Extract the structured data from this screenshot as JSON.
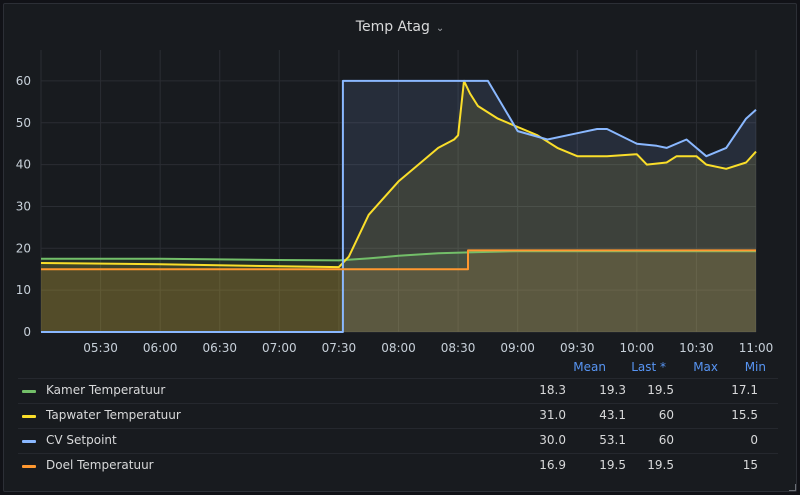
{
  "panel": {
    "title": "Temp Atag"
  },
  "legend": {
    "headers": [
      "Mean",
      "Last *",
      "Max",
      "Min"
    ],
    "rows": [
      {
        "name": "Kamer Temperatuur",
        "color": "#73bf69",
        "values": [
          "18.3",
          "19.3",
          "19.5",
          "17.1"
        ]
      },
      {
        "name": "Tapwater Temperatuur",
        "color": "#fade2a",
        "values": [
          "31.0",
          "43.1",
          "60",
          "15.5"
        ]
      },
      {
        "name": "CV Setpoint",
        "color": "#8ab8ff",
        "values": [
          "30.0",
          "53.1",
          "60",
          "0"
        ]
      },
      {
        "name": "Doel Temperatuur",
        "color": "#ff9830",
        "values": [
          "16.9",
          "19.5",
          "19.5",
          "15"
        ]
      }
    ]
  },
  "chart_data": {
    "type": "area",
    "title": "Temp Atag",
    "xlabel": "",
    "ylabel": "",
    "ylim": [
      0,
      65
    ],
    "y_ticks": [
      0,
      10,
      20,
      30,
      40,
      50,
      60
    ],
    "x_ticks": [
      "05:30",
      "06:00",
      "06:30",
      "07:00",
      "07:30",
      "08:00",
      "08:30",
      "09:00",
      "09:30",
      "10:00",
      "10:30",
      "11:00"
    ],
    "x_range": [
      "05:00",
      "11:00"
    ],
    "grid": true,
    "legend_position": "bottom",
    "series": [
      {
        "name": "Kamer Temperatuur",
        "color": "#73bf69",
        "points": [
          [
            "05:00",
            17.5
          ],
          [
            "06:00",
            17.5
          ],
          [
            "07:00",
            17.2
          ],
          [
            "07:30",
            17.1
          ],
          [
            "07:45",
            17.6
          ],
          [
            "08:00",
            18.2
          ],
          [
            "08:20",
            18.8
          ],
          [
            "08:40",
            19.1
          ],
          [
            "09:00",
            19.3
          ],
          [
            "10:00",
            19.3
          ],
          [
            "11:00",
            19.3
          ]
        ]
      },
      {
        "name": "Tapwater Temperatuur",
        "color": "#fade2a",
        "points": [
          [
            "05:00",
            16.5
          ],
          [
            "06:00",
            16.2
          ],
          [
            "07:00",
            15.7
          ],
          [
            "07:30",
            15.5
          ],
          [
            "07:35",
            18
          ],
          [
            "07:45",
            28
          ],
          [
            "08:00",
            36
          ],
          [
            "08:10",
            40
          ],
          [
            "08:20",
            44
          ],
          [
            "08:28",
            46
          ],
          [
            "08:30",
            47
          ],
          [
            "08:33",
            60
          ],
          [
            "08:36",
            57
          ],
          [
            "08:40",
            54
          ],
          [
            "08:50",
            51
          ],
          [
            "09:00",
            49
          ],
          [
            "09:10",
            47
          ],
          [
            "09:20",
            44
          ],
          [
            "09:30",
            42
          ],
          [
            "09:45",
            42
          ],
          [
            "10:00",
            42.5
          ],
          [
            "10:05",
            40
          ],
          [
            "10:15",
            40.5
          ],
          [
            "10:20",
            42
          ],
          [
            "10:30",
            42
          ],
          [
            "10:35",
            40
          ],
          [
            "10:45",
            39
          ],
          [
            "10:55",
            40.5
          ],
          [
            "11:00",
            43.1
          ]
        ]
      },
      {
        "name": "CV Setpoint",
        "color": "#8ab8ff",
        "points": [
          [
            "05:00",
            0
          ],
          [
            "07:32",
            0
          ],
          [
            "07:32",
            60
          ],
          [
            "08:45",
            60
          ],
          [
            "09:00",
            48
          ],
          [
            "09:15",
            46
          ],
          [
            "09:30",
            47.5
          ],
          [
            "09:40",
            48.5
          ],
          [
            "09:45",
            48.5
          ],
          [
            "10:00",
            45
          ],
          [
            "10:10",
            44.5
          ],
          [
            "10:15",
            44
          ],
          [
            "10:25",
            46
          ],
          [
            "10:30",
            44
          ],
          [
            "10:35",
            42
          ],
          [
            "10:45",
            44
          ],
          [
            "10:55",
            51
          ],
          [
            "11:00",
            53.1
          ]
        ]
      },
      {
        "name": "Doel Temperatuur",
        "color": "#ff9830",
        "points": [
          [
            "05:00",
            15
          ],
          [
            "08:35",
            15
          ],
          [
            "08:35",
            19.5
          ],
          [
            "11:00",
            19.5
          ]
        ]
      }
    ]
  }
}
